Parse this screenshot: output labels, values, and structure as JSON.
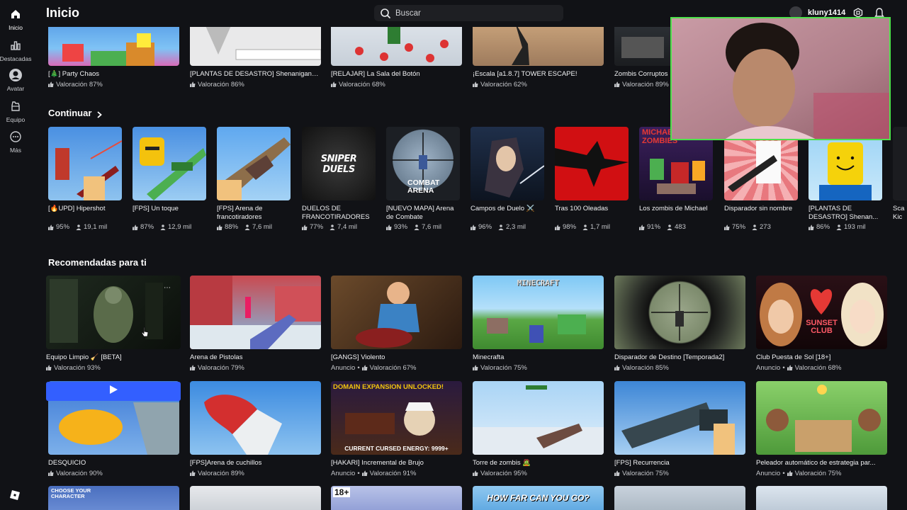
{
  "sidebar": {
    "items": [
      {
        "label": "Inicio",
        "icon": "home-icon"
      },
      {
        "label": "Destacadas",
        "icon": "charts-icon"
      },
      {
        "label": "Avatar",
        "icon": "avatar-icon"
      },
      {
        "label": "Equipo",
        "icon": "inventory-icon"
      },
      {
        "label": "Más",
        "icon": "more-icon"
      }
    ]
  },
  "header": {
    "title": "Inicio",
    "search_placeholder": "Buscar",
    "username": "kluny1414"
  },
  "top_row": [
    {
      "title": "[🎄] Party Chaos",
      "rating": "Valoración 87%"
    },
    {
      "title": "[PLANTAS DE DESASTRO] Shenanigans ...",
      "rating": "Valoración 86%"
    },
    {
      "title": "[RELAJAR] La Sala del Botón",
      "rating": "Valoración 68%"
    },
    {
      "title": "¡Escala [a1.8.7] TOWER ESCAPE!",
      "rating": "Valoración 62%"
    },
    {
      "title": "Zombis Corruptos",
      "rating": "Valoración 89%"
    }
  ],
  "continue": {
    "title": "Continuar",
    "items": [
      {
        "title": "[🔥UPD] Hipershot",
        "rating": "95%",
        "players": "19,1 mil"
      },
      {
        "title": "[FPS] Un toque",
        "rating": "87%",
        "players": "12,9 mil"
      },
      {
        "title": "[FPS] Arena de francotiradores",
        "rating": "88%",
        "players": "7,6 mil"
      },
      {
        "title": "DUELOS DE FRANCOTIRADORES",
        "rating": "77%",
        "players": "7,4 mil",
        "thumb_text": "SNIPER DUELS"
      },
      {
        "title": "[NUEVO MAPA] Arena de Combate",
        "rating": "93%",
        "players": "7,6 mil",
        "thumb_text": "COMBAT ARENA"
      },
      {
        "title": "Campos de Duelo ⚔️",
        "rating": "96%",
        "players": "2,3 mil"
      },
      {
        "title": "Tras 100 Oleadas",
        "rating": "98%",
        "players": "1,7 mil"
      },
      {
        "title": "Los zombis de Michael",
        "rating": "91%",
        "players": "483",
        "thumb_text": "MICHAEL ZOMBIES"
      },
      {
        "title": "Disparador sin nombre",
        "rating": "75%",
        "players": "273"
      },
      {
        "title": "[PLANTAS DE DESASTRO] Shenan...",
        "rating": "86%",
        "players": "193 mil"
      },
      {
        "title": "Sca Kic",
        "rating": "",
        "players": ""
      }
    ]
  },
  "recommended": {
    "title": "Recomendadas para ti",
    "row1": [
      {
        "title": "Equipo Limpio 🧹 [BETA]",
        "meta": "Valoración 93%",
        "ad": ""
      },
      {
        "title": "Arena de Pistolas",
        "meta": "Valoración 79%",
        "ad": ""
      },
      {
        "title": "[GANGS] Violento",
        "meta": "Valoración 67%",
        "ad": "Anuncio"
      },
      {
        "title": "Minecrafta",
        "meta": "Valoración 75%",
        "ad": "",
        "thumb_text": "MINECRAFT"
      },
      {
        "title": "Disparador de Destino [Temporada2]",
        "meta": "Valoración 85%",
        "ad": ""
      },
      {
        "title": "Club Puesta de Sol [18+]",
        "meta": "Valoración 68%",
        "ad": "Anuncio",
        "thumb_text": "SUNSET CLUB"
      }
    ],
    "row2": [
      {
        "title": "DESQUICIO",
        "meta": "Valoración 90%",
        "ad": ""
      },
      {
        "title": "[FPS]Arena de cuchillos",
        "meta": "Valoración 89%",
        "ad": ""
      },
      {
        "title": "[HAKARI] Incremental de Brujo",
        "meta": "Valoración 91%",
        "ad": "Anuncio",
        "thumb_text": "DOMAIN EXPANSION UNLOCKED!",
        "thumb_text2": "CURRENT CURSED ENERGY: 9999+"
      },
      {
        "title": "Torre de zombis 🧟",
        "meta": "Valoración 95%",
        "ad": ""
      },
      {
        "title": "[FPS] Recurrencia",
        "meta": "Valoración 75%",
        "ad": ""
      },
      {
        "title": "Peleador automático de estrategia par...",
        "meta": "Valoración 75%",
        "ad": "Anuncio"
      }
    ],
    "row3_texts": [
      "CHOOSE YOUR CHARACTER",
      "18+",
      "HOW FAR CAN YOU GO?"
    ]
  }
}
